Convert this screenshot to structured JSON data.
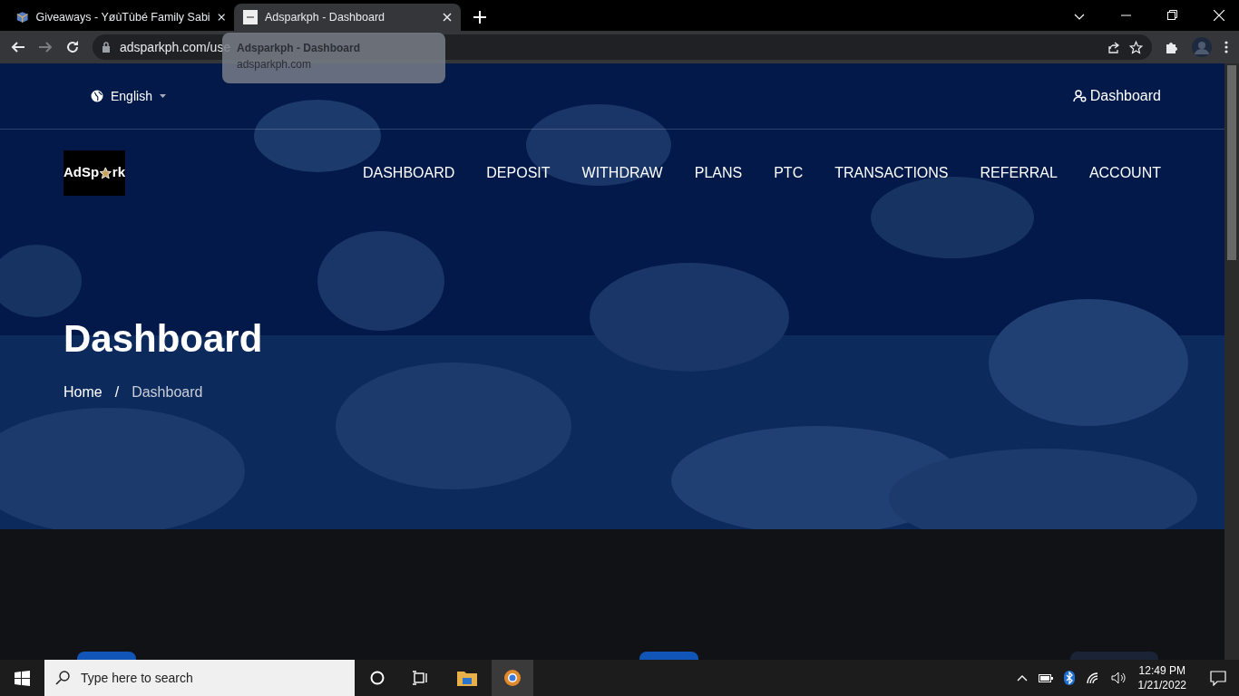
{
  "browser": {
    "tabs": [
      {
        "title": "Giveaways - YøùTùbé Family Sabi",
        "selected": false
      },
      {
        "title": "Adsparkph - Dashboard",
        "selected": true
      }
    ],
    "address": "adsparkph.com/use",
    "tooltip": {
      "title": "Adsparkph - Dashboard",
      "url": "adsparkph.com"
    }
  },
  "page": {
    "language": "English",
    "account_link": "Dashboard",
    "logo": {
      "before": "AdSp",
      "after": "rk"
    },
    "nav": [
      "DASHBOARD",
      "DEPOSIT",
      "WITHDRAW",
      "PLANS",
      "PTC",
      "TRANSACTIONS",
      "REFERRAL",
      "ACCOUNT"
    ],
    "title": "Dashboard",
    "breadcrumb": [
      {
        "label": "Home",
        "selected": false
      },
      {
        "label": "Dashboard",
        "selected": true
      }
    ],
    "separator": "/",
    "cards": [
      {
        "kind": "blue"
      },
      {
        "kind": "blue"
      },
      {
        "kind": "dark"
      }
    ]
  },
  "taskbar": {
    "search_placeholder": "Type here to search",
    "time": "12:49 PM",
    "date": "1/21/2022"
  }
}
